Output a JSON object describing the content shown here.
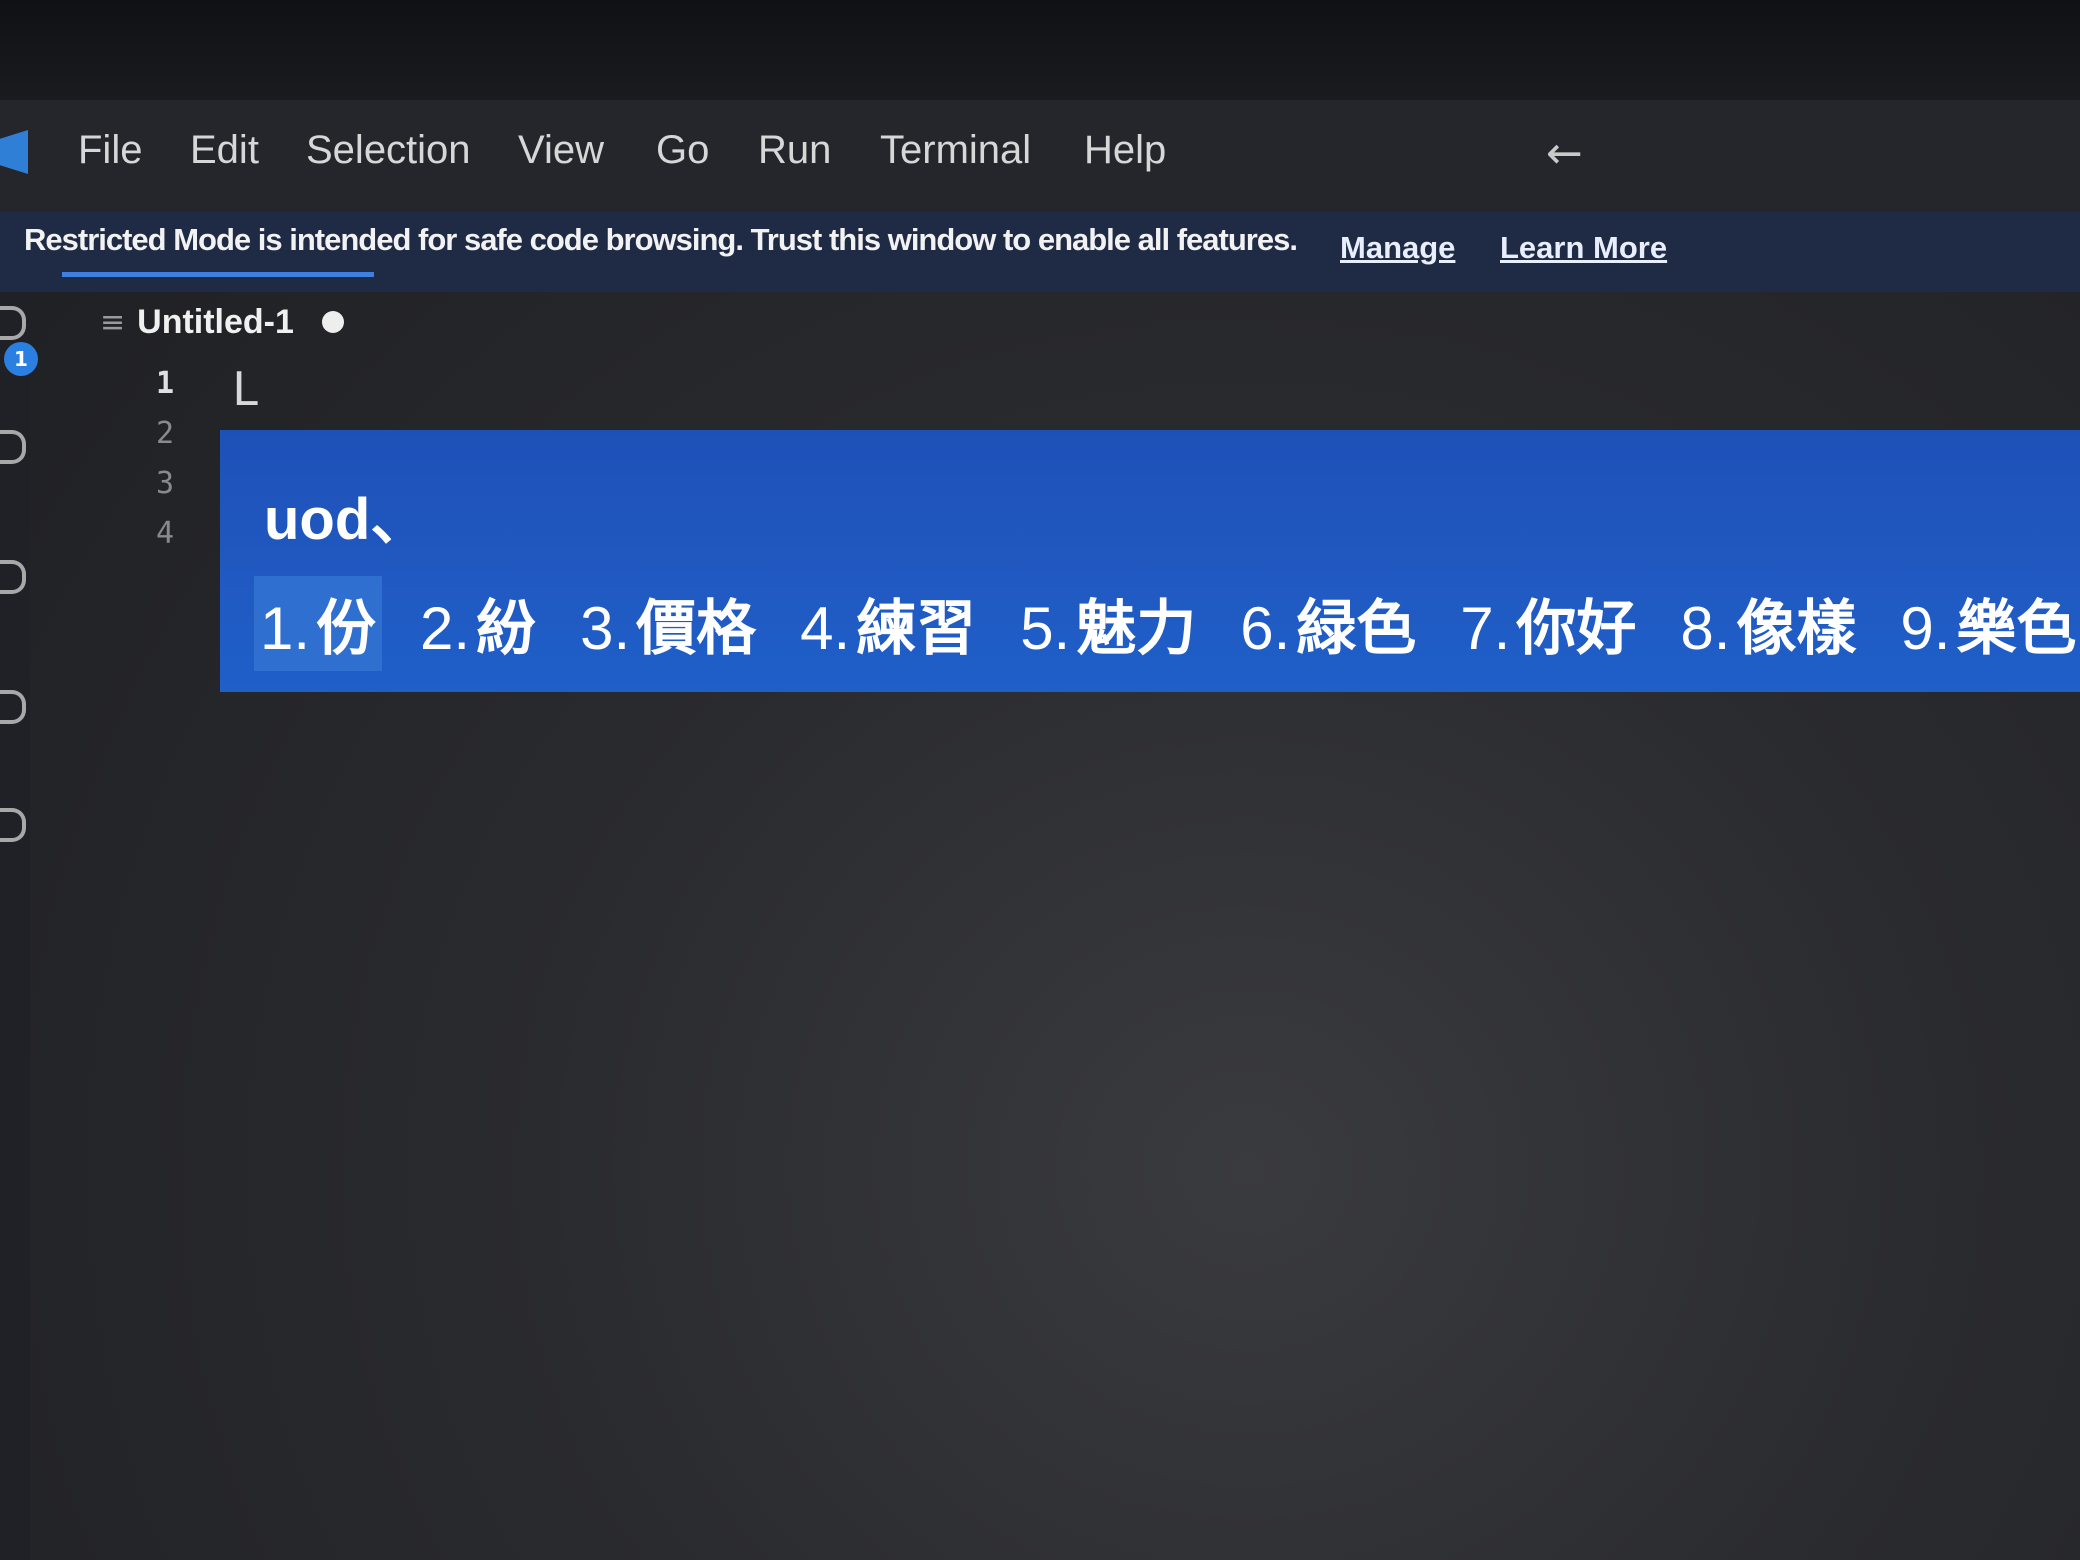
{
  "menubar": {
    "items": [
      "File",
      "Edit",
      "Selection",
      "View",
      "Go",
      "Run",
      "Terminal",
      "Help"
    ],
    "back_icon": "arrow-left-icon"
  },
  "banner": {
    "message": "Restricted Mode is intended for safe code browsing. Trust this window to enable all features.",
    "manage_label": "Manage",
    "learn_more_label": "Learn More"
  },
  "activity_bar": {
    "badge_count": "1"
  },
  "editor": {
    "tab_label": "Untitled-1",
    "line_numbers": [
      "1",
      "2",
      "3",
      "4"
    ],
    "cursor_char": "L"
  },
  "ime": {
    "composition": "uod、",
    "candidates": [
      {
        "num": "1.",
        "text": "份"
      },
      {
        "num": "2.",
        "text": "紛"
      },
      {
        "num": "3.",
        "text": "價格"
      },
      {
        "num": "4.",
        "text": "練習"
      },
      {
        "num": "5.",
        "text": "魅力"
      },
      {
        "num": "6.",
        "text": "緑色"
      },
      {
        "num": "7.",
        "text": "你好"
      },
      {
        "num": "8.",
        "text": "像樣"
      },
      {
        "num": "9.",
        "text": "樂色"
      }
    ],
    "selected_index": 0
  },
  "colors": {
    "menubar_bg": "#25262b",
    "banner_bg": "#1f2a44",
    "ime_bg": "#2058c0",
    "accent": "#2b7fe0"
  }
}
